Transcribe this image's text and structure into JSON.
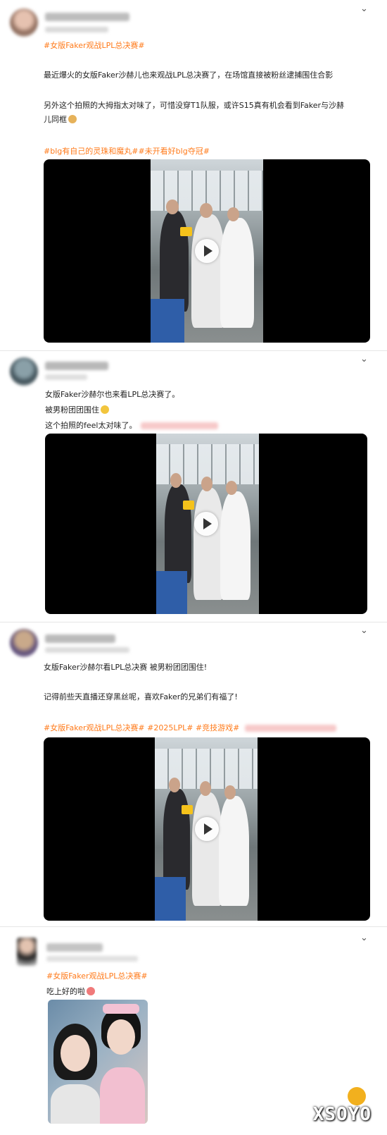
{
  "posts": [
    {
      "tag": "#女版Faker观战LPL总决赛#",
      "body1": "最近爆火的女版Faker沙赫儿也来观战LPL总决赛了，在场馆直接被粉丝逮捕围住合影",
      "body2": "另外这个拍照的大拇指太对味了，可惜没穿T1队服，或许S15真有机会看到Faker与沙赫",
      "body3": "儿同框",
      "tags2": "#blg有自己的灵珠和魔丸##未开看好blg夺冠#"
    },
    {
      "line1": "女版Faker沙赫尔也来看LPL总决赛了。",
      "line2": "被男粉团团围住",
      "line3": "这个拍照的feel太对味了。"
    },
    {
      "line1": "女版Faker沙赫尔看LPL总决赛 被男粉团团围住!",
      "line2": "记得前些天直播还穿黑丝呢，喜欢Faker的兄弟们有福了!",
      "tags": "#女版Faker观战LPL总决赛# #2025LPL# #竞技游戏#"
    },
    {
      "tag": "#女版Faker观战LPL总决赛#",
      "line1": "吃上好的啦"
    }
  ],
  "watermark": "XSOYO",
  "colors": {
    "tag": "#ff7a1a",
    "video_bg": "#000000"
  },
  "icons": {
    "expand": "chevron-down-icon",
    "play": "play-icon"
  }
}
